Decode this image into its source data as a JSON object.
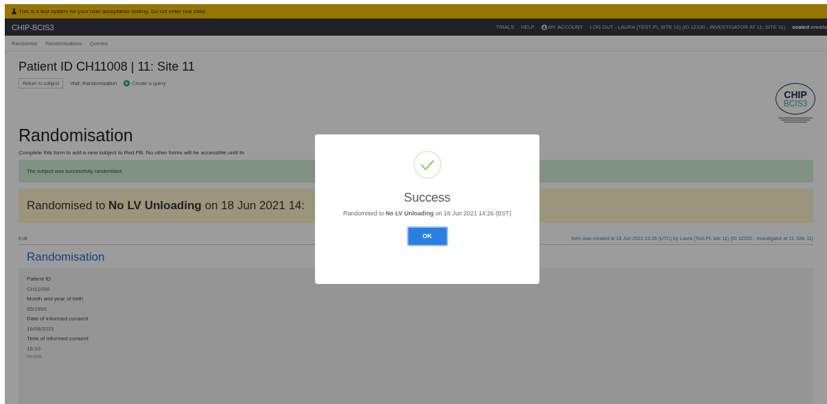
{
  "test_banner": {
    "text": "This is a test system for your user acceptance testing. Do not enter real data!"
  },
  "navbar": {
    "brand": "CHIP-BCIS3",
    "links": [
      {
        "label": "TRIALS",
        "kind": "plain"
      },
      {
        "label": "HELP",
        "kind": "plain"
      },
      {
        "label": "MY ACCOUNT",
        "kind": "account"
      },
      {
        "label": "LOG OUT - LAURA (TEST PI, SITE 11) (ID 12330 - INVESTIGATOR AT 11: SITE 11)",
        "kind": "plain"
      }
    ],
    "product": "**sealed** envelo"
  },
  "subnav": [
    "Randomise",
    "Randomisations",
    "Queries"
  ],
  "header": {
    "title": "Patient ID CH11008 | 11: Site 11",
    "return_button": "Return to subject",
    "visit": "Visit: Randomisation",
    "create_query": "Create a query",
    "logo": {
      "line_1": "CHIP",
      "line_2": "BCIS3"
    }
  },
  "form": {
    "title": "Randomisation",
    "description": "Complete this form to add a new subject to Red Pill. No other forms will be accessible until th",
    "alert": "The subject was successfully randomised.",
    "result": "Randomised to **No LV Unloading** on 18 Jun 2021 14:",
    "edit_link": "Edit",
    "meta": "form was created at 18 Jun 2021 13:26 (UTC) by Laura (Test PI, site 11) (ID 12330 - Investigator at 11: Site 11)",
    "section_title": "Randomisation",
    "fields": [
      {
        "label": "Patient ID",
        "value": "CH11008"
      },
      {
        "label": "Month and year of birth",
        "value": "05/1959"
      },
      {
        "label": "Date of informed consent",
        "value": "16/06/2021"
      },
      {
        "label": "Time of informed consent",
        "value": "16:10",
        "hint": "hh:mm"
      }
    ]
  },
  "modal": {
    "title": "Success",
    "message": "Randomised to **No LV Unloading** on 18 Jun 2021 14:26 (BST)",
    "button": "OK"
  }
}
